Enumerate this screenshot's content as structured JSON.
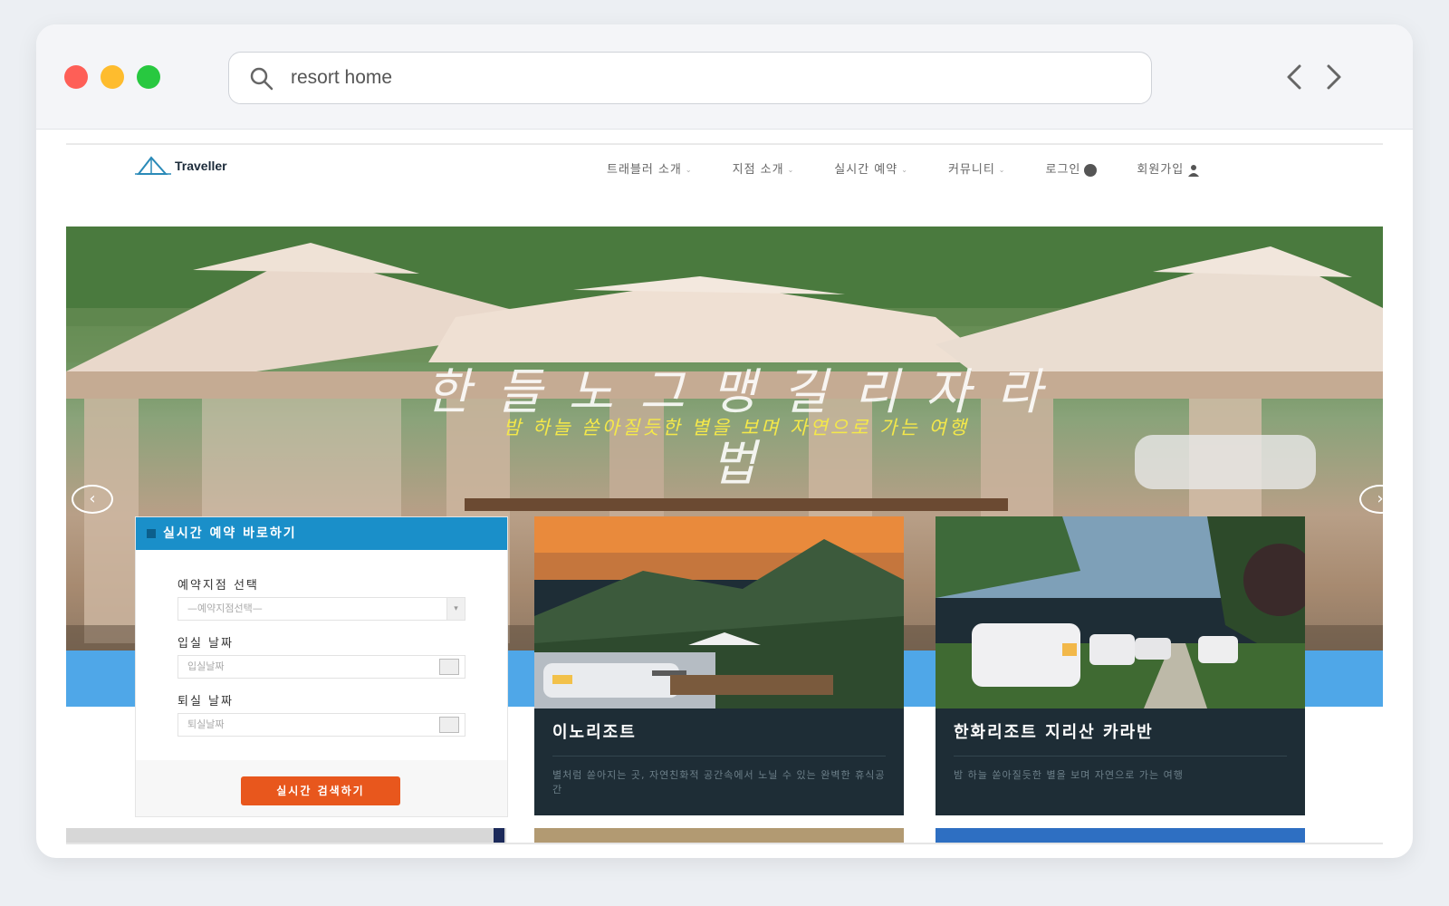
{
  "browser": {
    "url_text": "resort home"
  },
  "site": {
    "logo_text": "Traveller",
    "menu": [
      {
        "label": "트래블러 소개",
        "caret": "⌄"
      },
      {
        "label": "지점 소개",
        "caret": "⌄"
      },
      {
        "label": "실시간 예약",
        "caret": "⌄"
      },
      {
        "label": "커뮤니티",
        "caret": "⌄"
      },
      {
        "label": "로그인",
        "icon": "login-icon"
      },
      {
        "label": "회원가입",
        "icon": "user-icon"
      }
    ]
  },
  "hero": {
    "title": "한 들 노 그 맹 길 리 자 라 법",
    "subtitle": "밤 하늘 쏟아질듯한 별을 보며 자연으로 가는 여행",
    "prev_symbol": "‹",
    "next_symbol": "›"
  },
  "reserve": {
    "heading": "실시간 예약 바로하기",
    "branch_label": "예약지점 선택",
    "branch_placeholder": "—예약지점선택—",
    "checkin_label": "입실 날짜",
    "checkin_placeholder": "입실날짜",
    "checkout_label": "퇴실 날짜",
    "checkout_placeholder": "퇴실날짜",
    "search_label": "실시간 검색하기"
  },
  "cards": [
    {
      "title": "이노리조트",
      "desc": "별처럼 쏟아지는 곳, 자연친화적 공간속에서 노닐 수 있는 완벽한 휴식공간"
    },
    {
      "title": "한화리조트 지리산 카라반",
      "desc": "밤 하늘 쏟아질듯한 별을 보며 자연으로 가는 여행"
    }
  ],
  "colors": {
    "accent_blue": "#1a8fc9",
    "button_orange": "#e8571d",
    "card_bg": "#1e2d36",
    "subtitle_yellow": "#f4e84a"
  }
}
